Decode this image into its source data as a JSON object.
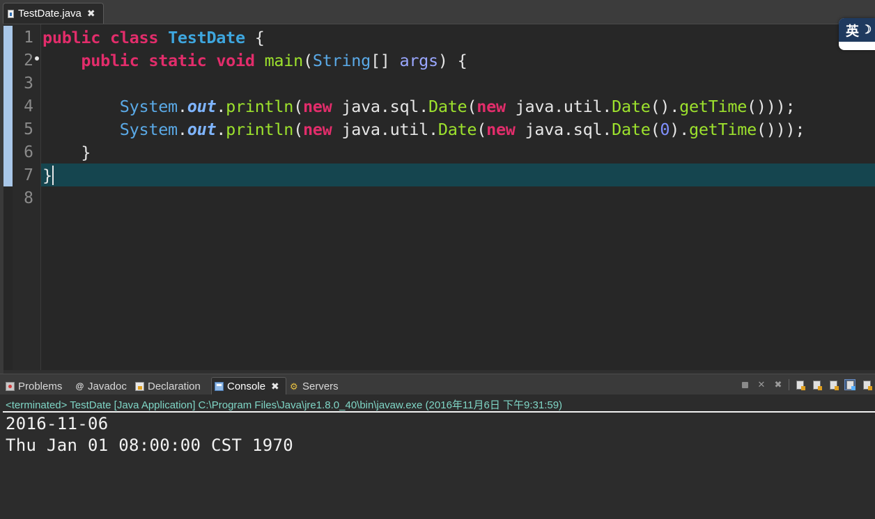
{
  "editor_tab": {
    "title": "TestDate.java",
    "close_glyph": "✖"
  },
  "ime": {
    "label": "英",
    "moon": "☽"
  },
  "line_numbers": [
    "1",
    "2",
    "3",
    "4",
    "5",
    "6",
    "7",
    "8"
  ],
  "code": {
    "l1": {
      "a": "public",
      "b": "class",
      "c": "TestDate",
      "d": "{"
    },
    "l2": {
      "a": "public",
      "b": "static",
      "c": "void",
      "d": "main",
      "e": "(",
      "f": "String",
      "g": "[] ",
      "h": "args",
      "i": ") {"
    },
    "l4": {
      "a": "System",
      "b": ".",
      "c": "out",
      "d": ".",
      "e": "println",
      "f": "(",
      "g": "new",
      "h": "java.sql.",
      "i": "Date",
      "j": "(",
      "k": "new",
      "l": "java.util.",
      "m": "Date",
      "n": "().",
      "o": "getTime",
      "p": "()));"
    },
    "l5": {
      "a": "System",
      "b": ".",
      "c": "out",
      "d": ".",
      "e": "println",
      "f": "(",
      "g": "new",
      "h": "java.util.",
      "i": "Date",
      "j": "(",
      "k": "new",
      "l": "java.sql.",
      "m": "Date",
      "n": "(",
      "o": "0",
      "p": ").",
      "q": "getTime",
      "r": "()));"
    },
    "l6": "}",
    "l7": "}"
  },
  "views": {
    "problems": "Problems",
    "javadoc": "Javadoc",
    "declaration": "Declaration",
    "console": "Console",
    "servers": "Servers",
    "console_close": "✖"
  },
  "console": {
    "header": "<terminated> TestDate [Java Application] C:\\Program Files\\Java\\jre1.8.0_40\\bin\\javaw.exe (2016年11月6日 下午9:31:59)",
    "output": [
      "2016-11-06",
      "Thu Jan 01 08:00:00 CST 1970"
    ]
  },
  "colors": {
    "keyword": "#e22d6b",
    "class_name": "#3ea6de",
    "method": "#9de22d",
    "current_line": "#15454f",
    "console_header": "#7fd6c6"
  }
}
